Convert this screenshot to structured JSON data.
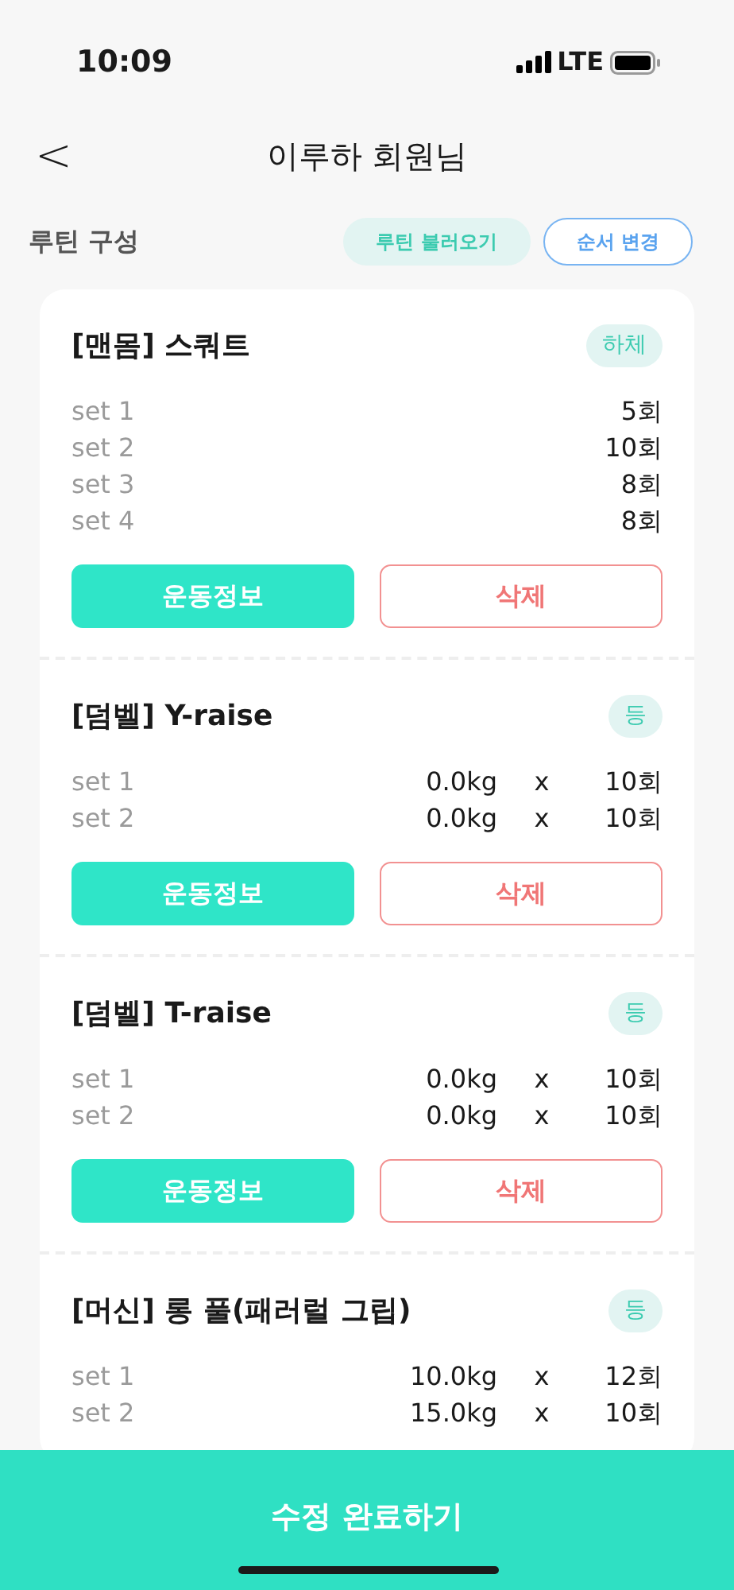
{
  "status_bar": {
    "time": "10:09",
    "network": "LTE"
  },
  "header": {
    "back": "<",
    "title": "이루하 회원님"
  },
  "section": {
    "title": "루틴 구성",
    "buttons": [
      {
        "label": "루틴 불러오기",
        "kind": "filled"
      },
      {
        "label": "순서 변경",
        "kind": "outline"
      }
    ]
  },
  "exercises": [
    {
      "name": "[맨몸] 스쿼트",
      "tag": "하체",
      "sets": [
        {
          "label": "set 1",
          "reps": "5회"
        },
        {
          "label": "set 2",
          "reps": "10회"
        },
        {
          "label": "set 3",
          "reps": "8회"
        },
        {
          "label": "set 4",
          "reps": "8회"
        }
      ],
      "info_button": "운동정보",
      "delete_button": "삭제"
    },
    {
      "name": "[덤벨] Y-raise",
      "tag": "등",
      "sets": [
        {
          "label": "set 1",
          "weight": "0.0kg",
          "times": "x",
          "reps": "10회"
        },
        {
          "label": "set 2",
          "weight": "0.0kg",
          "times": "x",
          "reps": "10회"
        }
      ],
      "info_button": "운동정보",
      "delete_button": "삭제"
    },
    {
      "name": "[덤벨] T-raise",
      "tag": "등",
      "sets": [
        {
          "label": "set 1",
          "weight": "0.0kg",
          "times": "x",
          "reps": "10회"
        },
        {
          "label": "set 2",
          "weight": "0.0kg",
          "times": "x",
          "reps": "10회"
        }
      ],
      "info_button": "운동정보",
      "delete_button": "삭제"
    },
    {
      "name": "[머신] 롱 풀(패러럴 그립)",
      "tag": "등",
      "sets": [
        {
          "label": "set 1",
          "weight": "10.0kg",
          "times": "x",
          "reps": "12회"
        },
        {
          "label": "set 2",
          "weight": "15.0kg",
          "times": "x",
          "reps": "10회"
        }
      ]
    }
  ],
  "footer_button": "수정 완료하기"
}
